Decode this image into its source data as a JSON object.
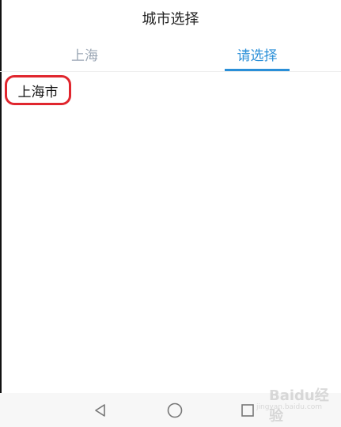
{
  "header": {
    "title": "城市选择"
  },
  "tabs": [
    {
      "label": "上海",
      "active": false
    },
    {
      "label": "请选择",
      "active": true
    }
  ],
  "cities": [
    {
      "label": "上海市",
      "highlighted": true
    }
  ],
  "nav_bar": {
    "back_icon": "triangle-back-icon",
    "home_icon": "circle-home-icon",
    "recent_icon": "square-recent-icon"
  },
  "watermark": {
    "text": "Baidu经验",
    "url": "jingyan.baidu.com"
  },
  "colors": {
    "accent": "#2a8fd8",
    "inactive_tab": "#9aa6b4",
    "highlight_border": "#e0262e"
  }
}
